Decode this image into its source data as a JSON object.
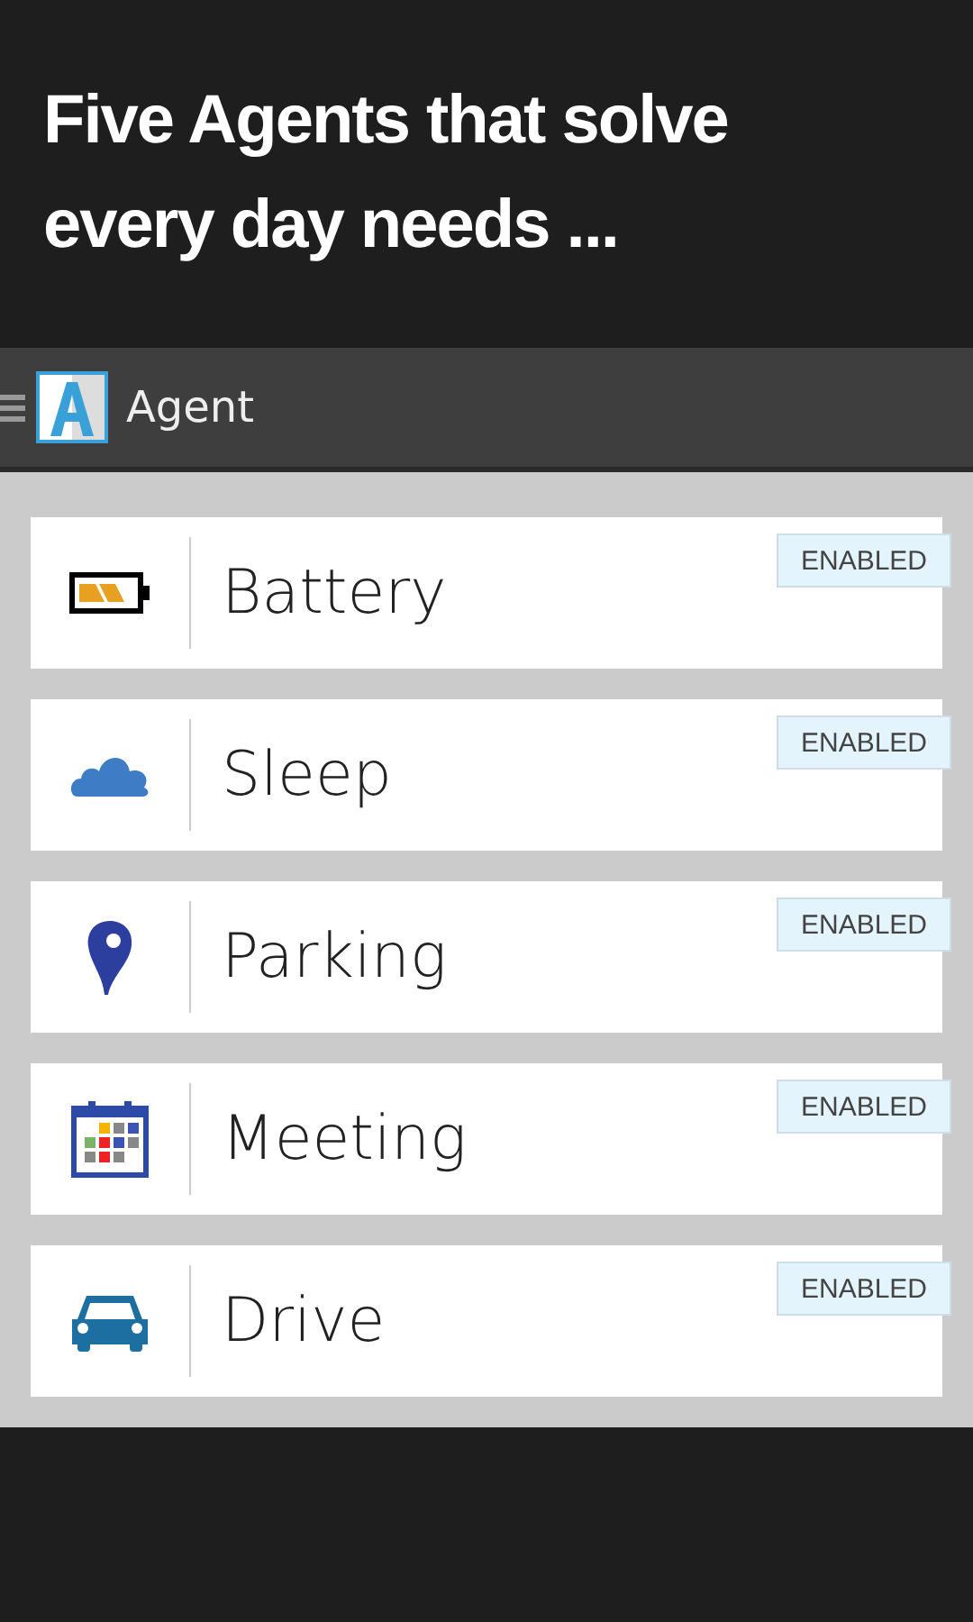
{
  "headline": "Five Agents that solve every day needs ...",
  "app_bar": {
    "title": "Agent"
  },
  "agents": [
    {
      "kind": "battery",
      "name": "Battery",
      "status": "ENABLED"
    },
    {
      "kind": "cloud",
      "name": "Sleep",
      "status": "ENABLED"
    },
    {
      "kind": "pin",
      "name": "Parking",
      "status": "ENABLED"
    },
    {
      "kind": "calendar",
      "name": "Meeting",
      "status": "ENABLED"
    },
    {
      "kind": "car",
      "name": "Drive",
      "status": "ENABLED"
    }
  ]
}
